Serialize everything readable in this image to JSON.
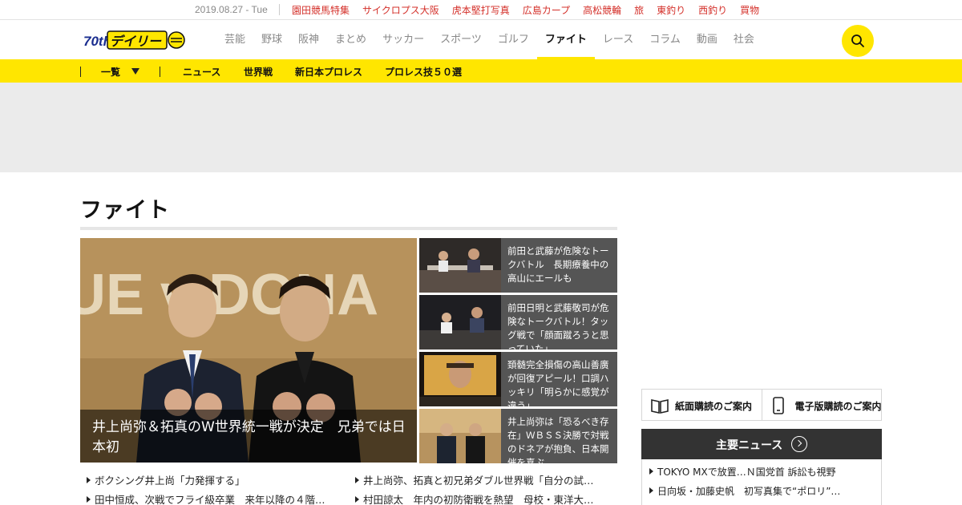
{
  "topbar": {
    "date": "2019.08.27 - Tue",
    "links": [
      "園田競馬特集",
      "サイクロプス大阪",
      "虎本堅打写真",
      "広島カープ",
      "高松競輪",
      "旅",
      "東釣り",
      "西釣り",
      "買物"
    ]
  },
  "header": {
    "logo_text": "デイリー",
    "logo_badge": "70th",
    "nav": [
      "芸能",
      "野球",
      "阪神",
      "まとめ",
      "サッカー",
      "スポーツ",
      "ゴルフ",
      "ファイト",
      "レース",
      "コラム",
      "動画",
      "社会"
    ],
    "active_nav": "ファイト"
  },
  "subnav": {
    "dropdown_label": "一覧",
    "items": [
      "ニュース",
      "世界戦",
      "新日本プロレス",
      "プロレス技５０選"
    ]
  },
  "section": {
    "title": "ファイト"
  },
  "hero": {
    "headline": "井上尚弥＆拓真のW世界統一戦が決定　兄弟では日本初",
    "backdrop_text": "UE v DONA"
  },
  "side_articles": [
    {
      "text": "前田と武藤が危険なトークバトル　長期療養中の高山にエールも"
    },
    {
      "text": "前田日明と武藤敬司が危険なトークバトル！タッグ戦で「顔面蹴ろうと思っていた」"
    },
    {
      "text": "頚髄完全損傷の高山善廣が回復アピール！口調ハッキリ「明らかに感覚が違う」"
    },
    {
      "text": "井上尚弥は「恐るべき存在」ＷＢＳＳ決勝で対戦のドネアが抱負、日本開催を喜ぶ"
    }
  ],
  "news_list": {
    "left": [
      "ボクシング井上尚「力発揮する」",
      "田中恒成、次戦でフライ級卒業　来年以降の４階…"
    ],
    "right": [
      "井上尚弥、拓真と初兄弟ダブル世界戦「自分の試…",
      "村田諒太　年内の初防衛戦を熱望　母校・東洋大…"
    ]
  },
  "subscription": {
    "print_label": "紙面購読のご案内",
    "digital_label": "電子版購読のご案内"
  },
  "main_news": {
    "title": "主要ニュース",
    "items": [
      "TOKYO MXで放置…Ｎ国党首 訴訟も視野",
      "日向坂・加藤史帆　初写真集で“ポロリ”…"
    ]
  },
  "colors": {
    "brand_yellow": "#ffe600",
    "link_red": "#d4302a",
    "ad_gray": "#ebebeb"
  }
}
